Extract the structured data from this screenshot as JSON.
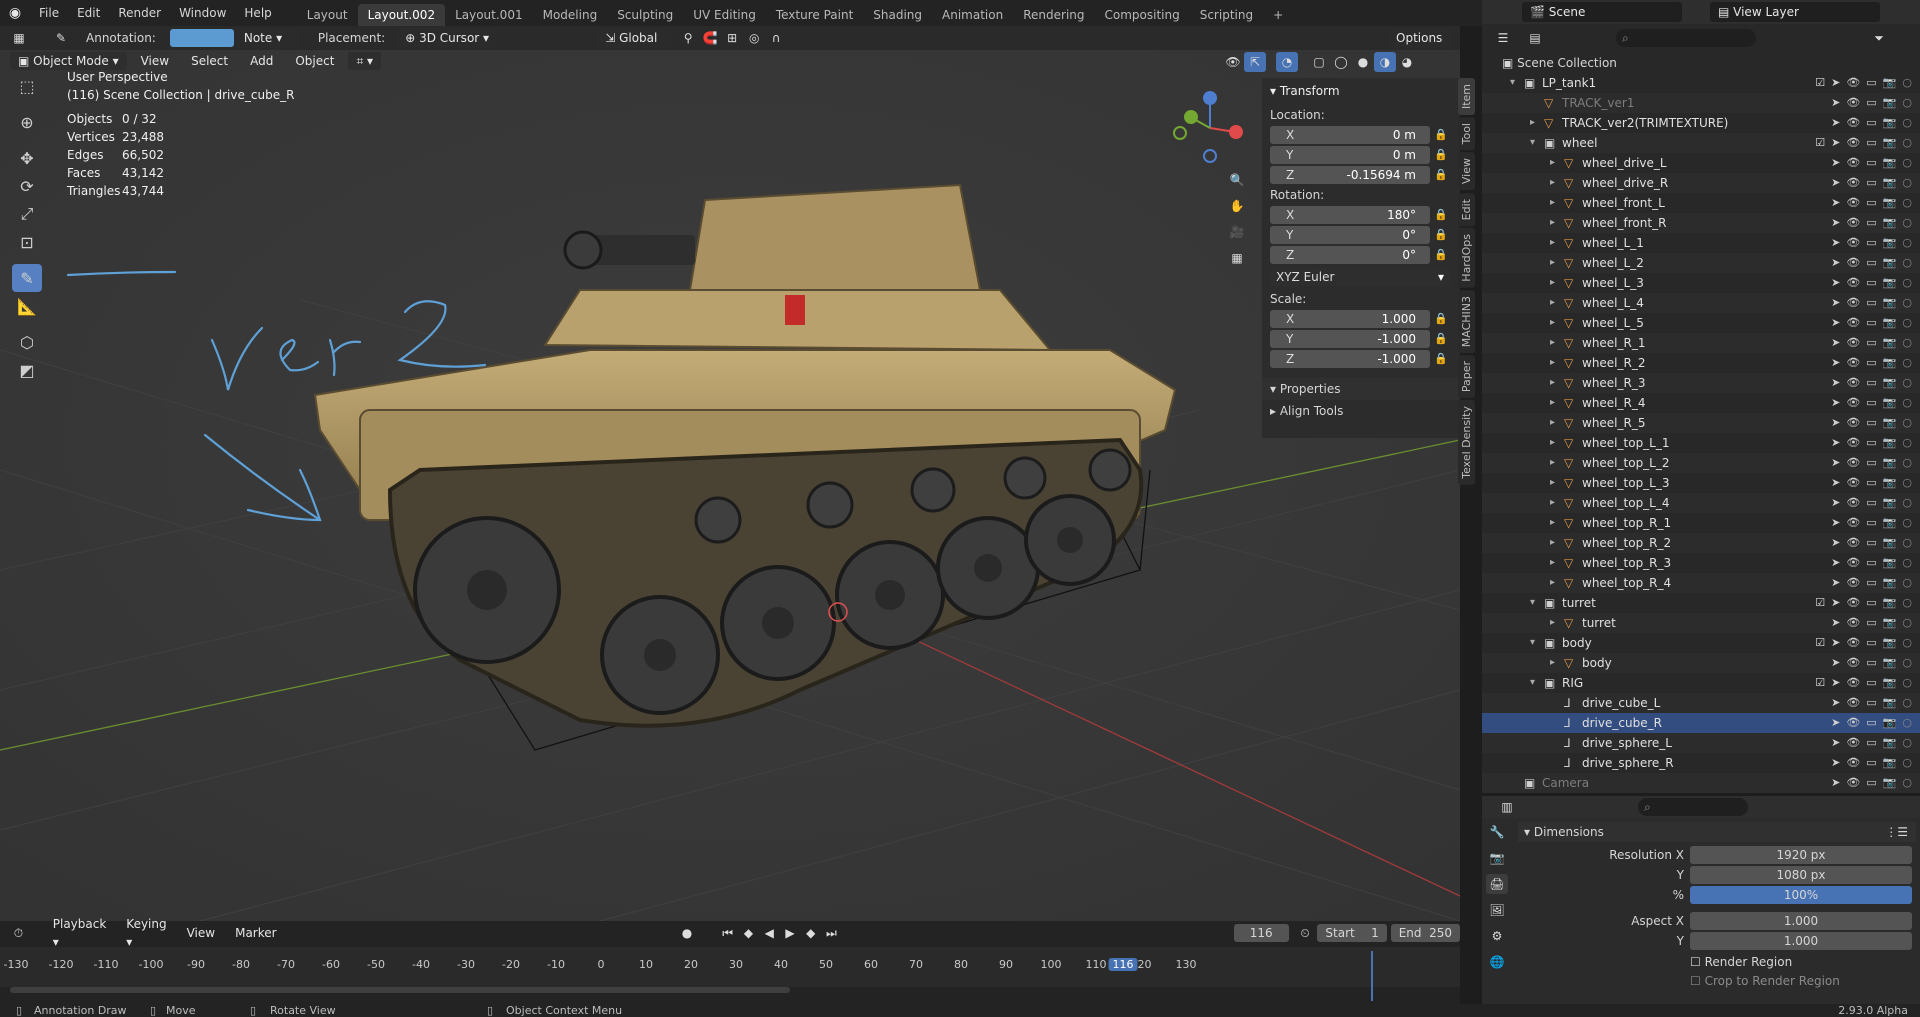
{
  "topbar": {
    "menus": [
      "File",
      "Edit",
      "Render",
      "Window",
      "Help"
    ],
    "workspaces": [
      "Layout",
      "Layout.002",
      "Layout.001",
      "Modeling",
      "Sculpting",
      "UV Editing",
      "Texture Paint",
      "Shading",
      "Animation",
      "Rendering",
      "Compositing",
      "Scripting"
    ],
    "active_workspace": "Layout.002",
    "scene_label": "Scene",
    "view_layer_label": "View Layer"
  },
  "tool_header": {
    "annotation_label": "Annotation:",
    "note_label": "Note",
    "placement_label": "Placement:",
    "placement_value": "3D Cursor",
    "orientation": "Global",
    "options_label": "Options"
  },
  "viewport_header": {
    "mode": "Object Mode",
    "menus": [
      "View",
      "Select",
      "Add",
      "Object"
    ]
  },
  "overlay": {
    "perspective": "User Perspective",
    "collection": "(116) Scene Collection | drive_cube_R",
    "stats": [
      {
        "k": "Objects",
        "v": "0 / 32"
      },
      {
        "k": "Vertices",
        "v": "23,488"
      },
      {
        "k": "Edges",
        "v": "66,502"
      },
      {
        "k": "Faces",
        "v": "43,142"
      },
      {
        "k": "Triangles",
        "v": "43,744"
      }
    ],
    "annotation_text": "Ver 2"
  },
  "npanel": {
    "transform_title": "Transform",
    "location_label": "Location:",
    "location": [
      {
        "a": "X",
        "v": "0 m"
      },
      {
        "a": "Y",
        "v": "0 m"
      },
      {
        "a": "Z",
        "v": "-0.15694 m"
      }
    ],
    "rotation_label": "Rotation:",
    "rotation": [
      {
        "a": "X",
        "v": "180°"
      },
      {
        "a": "Y",
        "v": "0°"
      },
      {
        "a": "Z",
        "v": "0°"
      }
    ],
    "rotation_mode": "XYZ Euler",
    "scale_label": "Scale:",
    "scale": [
      {
        "a": "X",
        "v": "1.000"
      },
      {
        "a": "Y",
        "v": "-1.000"
      },
      {
        "a": "Z",
        "v": "-1.000"
      }
    ],
    "properties_title": "Properties",
    "align_title": "Align Tools",
    "tabs": [
      "Item",
      "Tool",
      "View",
      "Edit",
      "HardOps",
      "MACHIN3",
      "Paper",
      "Texel Density"
    ]
  },
  "outliner": {
    "root": "Scene Collection",
    "rows": [
      {
        "name": "LP_tank1",
        "kind": "collection"
      },
      {
        "name": "TRACK_ver1",
        "kind": "object",
        "dim": true
      },
      {
        "name": "TRACK_ver2(TRIMTEXTURE)",
        "kind": "object"
      },
      {
        "name": "wheel",
        "kind": "collection"
      },
      {
        "name": "wheel_drive_L",
        "kind": "mesh"
      },
      {
        "name": "wheel_drive_R",
        "kind": "mesh"
      },
      {
        "name": "wheel_front_L",
        "kind": "mesh"
      },
      {
        "name": "wheel_front_R",
        "kind": "mesh"
      },
      {
        "name": "wheel_L_1",
        "kind": "mesh"
      },
      {
        "name": "wheel_L_2",
        "kind": "mesh"
      },
      {
        "name": "wheel_L_3",
        "kind": "mesh"
      },
      {
        "name": "wheel_L_4",
        "kind": "mesh"
      },
      {
        "name": "wheel_L_5",
        "kind": "mesh"
      },
      {
        "name": "wheel_R_1",
        "kind": "mesh"
      },
      {
        "name": "wheel_R_2",
        "kind": "mesh"
      },
      {
        "name": "wheel_R_3",
        "kind": "mesh"
      },
      {
        "name": "wheel_R_4",
        "kind": "mesh"
      },
      {
        "name": "wheel_R_5",
        "kind": "mesh"
      },
      {
        "name": "wheel_top_L_1",
        "kind": "mesh"
      },
      {
        "name": "wheel_top_L_2",
        "kind": "mesh"
      },
      {
        "name": "wheel_top_L_3",
        "kind": "mesh"
      },
      {
        "name": "wheel_top_L_4",
        "kind": "mesh"
      },
      {
        "name": "wheel_top_R_1",
        "kind": "mesh"
      },
      {
        "name": "wheel_top_R_2",
        "kind": "mesh"
      },
      {
        "name": "wheel_top_R_3",
        "kind": "mesh"
      },
      {
        "name": "wheel_top_R_4",
        "kind": "mesh"
      },
      {
        "name": "turret",
        "kind": "collection"
      },
      {
        "name": "turret",
        "kind": "mesh"
      },
      {
        "name": "body",
        "kind": "collection"
      },
      {
        "name": "body",
        "kind": "mesh"
      },
      {
        "name": "RIG",
        "kind": "collection"
      },
      {
        "name": "drive_cube_L",
        "kind": "empty"
      },
      {
        "name": "drive_cube_R",
        "kind": "empty",
        "selected": true
      },
      {
        "name": "drive_sphere_L",
        "kind": "empty"
      },
      {
        "name": "drive_sphere_R",
        "kind": "empty"
      },
      {
        "name": "Camera",
        "kind": "camera",
        "dim": true
      }
    ]
  },
  "properties": {
    "panel_title": "Dimensions",
    "resolution_x_label": "Resolution X",
    "resolution_x": "1920 px",
    "y_label": "Y",
    "resolution_y": "1080 px",
    "pct_label": "%",
    "pct": "100%",
    "aspect_x_label": "Aspect X",
    "aspect_x": "1.000",
    "aspect_y": "1.000",
    "render_region": "Render Region",
    "crop_region": "Crop to Render Region"
  },
  "timeline": {
    "menus": [
      "Playback",
      "Keying",
      "View",
      "Marker"
    ],
    "current_frame": "116",
    "start_label": "Start",
    "start": "1",
    "end_label": "End",
    "end": "250",
    "ticks": [
      "-130",
      "-120",
      "-110",
      "-100",
      "-90",
      "-80",
      "-70",
      "-60",
      "-50",
      "-40",
      "-30",
      "-20",
      "-10",
      "0",
      "10",
      "20",
      "30",
      "40",
      "50",
      "60",
      "70",
      "80",
      "90",
      "100",
      "110",
      "116",
      "120",
      "130"
    ]
  },
  "statusbar": {
    "items": [
      "Annotation Draw",
      "Move",
      "Rotate View",
      "Object Context Menu"
    ],
    "version": "2.93.0 Alpha"
  },
  "colors": {
    "accent": "#4772b3",
    "annotation": "#5fa0d6",
    "grid_x": "#8c3a3a",
    "grid_y": "#5f7e2f",
    "tank": "#a8915c"
  }
}
